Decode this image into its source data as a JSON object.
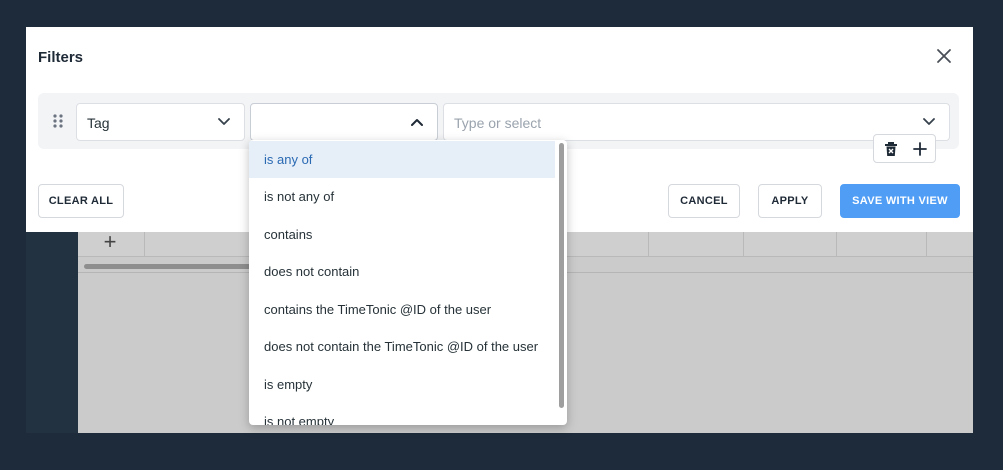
{
  "dialog": {
    "title": "Filters",
    "close_icon": "close-icon"
  },
  "filter": {
    "field_value": "Tag",
    "operator_value": "",
    "value_placeholder": "Type or select",
    "icons": {
      "drag": "drag-handle-icon",
      "chevron_down": "chevron-down-icon",
      "chevron_up": "chevron-up-icon",
      "delete": "trash-icon",
      "add": "plus-icon"
    }
  },
  "operator_options": [
    "is any of",
    "is not any of",
    "contains",
    "does not contain",
    "contains the TimeTonic @ID of the user",
    "does not contain the TimeTonic @ID of the user",
    "is empty",
    "is not empty"
  ],
  "selected_option": "is any of",
  "footer": {
    "clear_all": "CLEAR ALL",
    "cancel": "CANCEL",
    "apply": "APPLY",
    "save_with_view": "SAVE WITH VIEW"
  },
  "background": {
    "add_symbol": "+"
  },
  "colors": {
    "accent": "#4f9df5",
    "selected_bg": "#e6eef8",
    "selected_text": "#2a6ab3",
    "page_bg": "#1d2b3a"
  }
}
